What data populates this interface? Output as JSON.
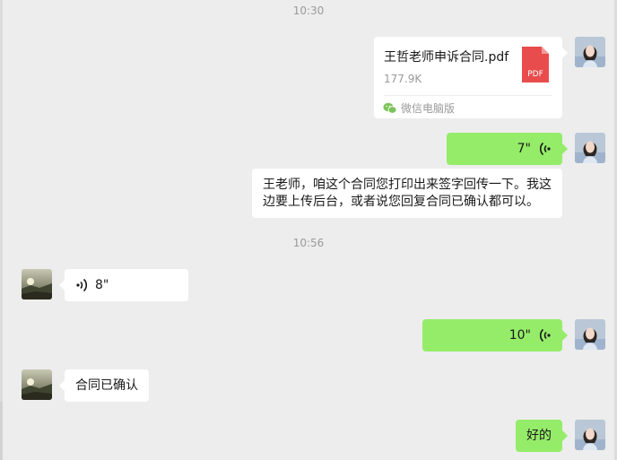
{
  "messages": {
    "ts1": "10:30",
    "file": {
      "name": "王哲老师申诉合同.pdf",
      "size": "177.9K",
      "type_label": "PDF",
      "source": "微信电脑版"
    },
    "voice_out_1": "7\"",
    "text_out_1": "王老师，咱这个合同您打印出来签字回传一下。我这边要上传后台，或者说您回复合同已确认都可以。",
    "ts2": "10:56",
    "voice_in_1": "8\"",
    "voice_out_2": "10\"",
    "text_in_1": "合同已确认",
    "text_out_2": "好的"
  },
  "icons": {
    "voice_out": "voice-wave-icon-left",
    "voice_in": "voice-wave-icon-right",
    "file": "pdf-file-icon",
    "source": "wechat-logo-icon"
  },
  "colors": {
    "outgoing_bubble": "#95ec69",
    "incoming_bubble": "#ffffff",
    "background": "#ededed",
    "pdf_red": "#e94c4c",
    "source_green": "#7dc45b"
  }
}
